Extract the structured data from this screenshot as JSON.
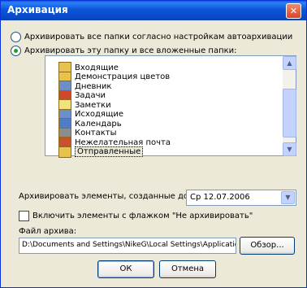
{
  "window": {
    "title": "Архивация",
    "close": "✕"
  },
  "options": {
    "archive_all": "Архивировать все папки согласно настройкам автоархивации",
    "archive_this": "Архивировать эту папку и все вложенные папки:"
  },
  "folders": [
    {
      "label": "Входящие",
      "icon": "inbox-icon",
      "color": "#e8c24a"
    },
    {
      "label": "Демонстрация цветов",
      "icon": "folder-icon",
      "color": "#e8c24a"
    },
    {
      "label": "Дневник",
      "icon": "journal-icon",
      "color": "#6d8fc8"
    },
    {
      "label": "Задачи",
      "icon": "tasks-icon",
      "color": "#d04a2a"
    },
    {
      "label": "Заметки",
      "icon": "notes-icon",
      "color": "#f2e27a"
    },
    {
      "label": "Исходящие",
      "icon": "outbox-icon",
      "color": "#6d8fc8"
    },
    {
      "label": "Календарь",
      "icon": "calendar-icon",
      "color": "#4f7cc4"
    },
    {
      "label": "Контакты",
      "icon": "contacts-icon",
      "color": "#8c8c8c"
    },
    {
      "label": "Нежелательная почта",
      "icon": "junk-mail-icon",
      "color": "#c9502c"
    },
    {
      "label": "Отправленные",
      "icon": "sent-icon",
      "color": "#e8c24a"
    }
  ],
  "archive_before": {
    "label": "Архивировать элементы, созданные до:",
    "value": "Ср 12.07.2006"
  },
  "include_checkbox": "Включить элементы с флажком \"Не архивировать\"",
  "file": {
    "label": "Файл архива:",
    "value": "D:\\Documents and Settings\\NikeG\\Local Settings\\Application",
    "browse": "Обзор..."
  },
  "buttons": {
    "ok": "ОК",
    "cancel": "Отмена"
  }
}
